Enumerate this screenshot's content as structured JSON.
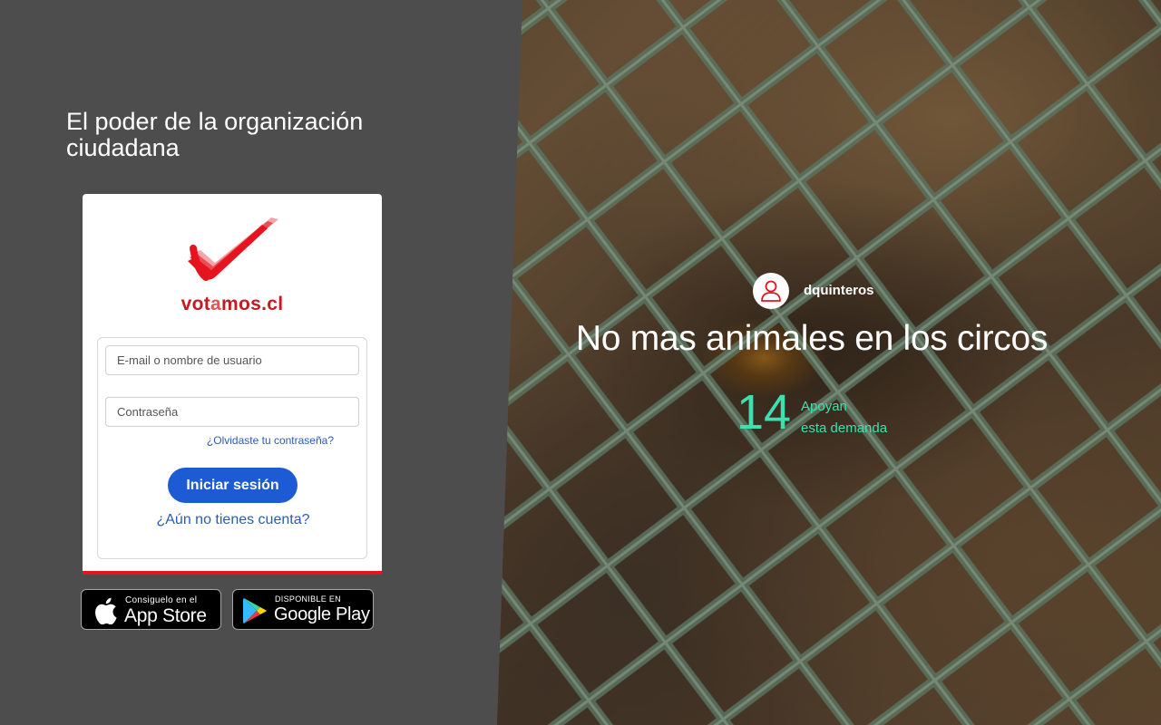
{
  "tagline": "El poder de la organización ciudadana",
  "brand": {
    "part1": "vot",
    "part2": "a",
    "part3": "mos.cl"
  },
  "login": {
    "email_placeholder": "E-mail o nombre de usuario",
    "password_placeholder": "Contraseña",
    "forgot_label": "¿Olvidaste tu contraseña?",
    "submit_label": "Iniciar sesión",
    "signup_label": "¿Aún no tienes cuenta?"
  },
  "stores": {
    "appstore": {
      "small": "Consiguelo en el",
      "big": "App Store",
      "icon": "apple-icon"
    },
    "gplay": {
      "small": "DISPONIBLE EN",
      "big": "Google Play",
      "icon": "google-play-icon"
    }
  },
  "demand": {
    "username": "dquinteros",
    "title": "No mas animales en los circos",
    "supporters": "14",
    "supporters_line1": "Apoyan",
    "supporters_line2": "esta demanda"
  },
  "colors": {
    "brand_red": "#e6141e",
    "primary_button": "#1d5bd4",
    "link": "#2a5bb5",
    "accent_green": "#3ee0b0",
    "left_panel_bg": "#4d4d4d"
  }
}
